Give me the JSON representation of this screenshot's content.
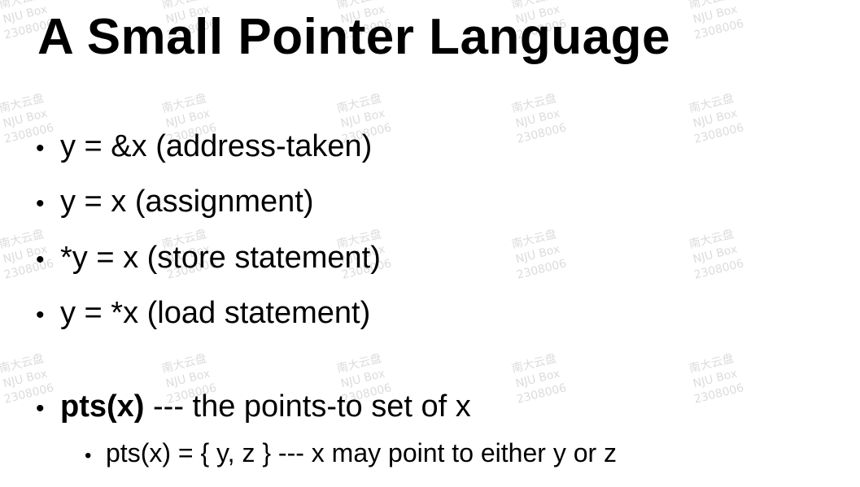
{
  "slide": {
    "title": "A Small Pointer Language",
    "bullets": [
      "y = &x (address-taken)",
      "y = x (assignment)",
      "*y = x (store statement)",
      "y = *x (load statement)"
    ],
    "definition": {
      "term": "pts(x)",
      "rest": " --- the points-to set of x",
      "sub": "pts(x) = { y, z }  --- x may point to either y or z"
    }
  },
  "watermark": {
    "line1": "南大云盘",
    "line2": "NJU Box",
    "line3": "2308006"
  }
}
